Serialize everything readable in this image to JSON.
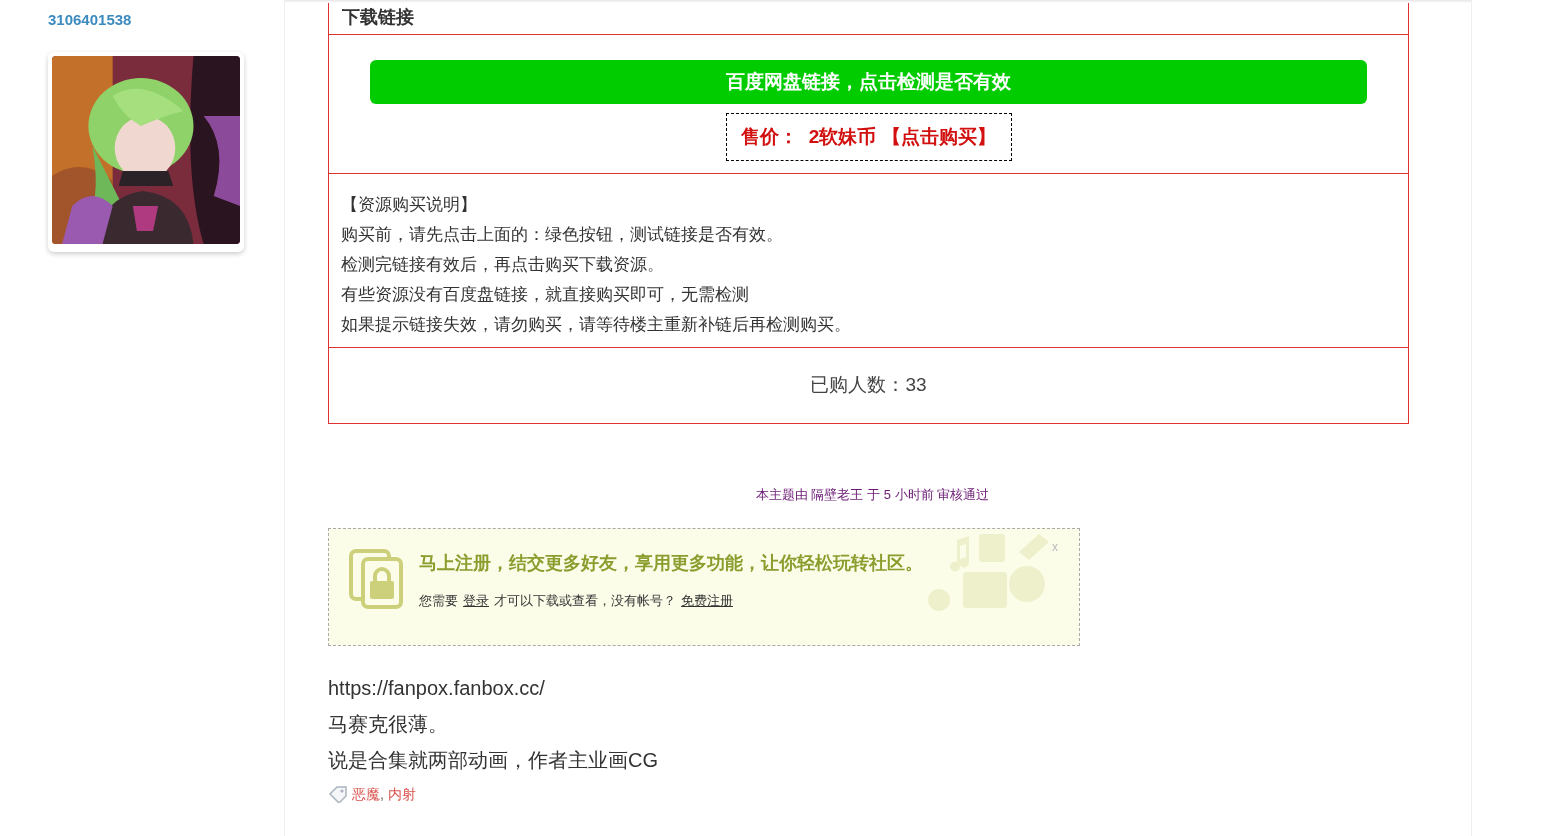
{
  "sidebar": {
    "username": "3106401538"
  },
  "download": {
    "header": "下载链接",
    "check_button": "百度网盘链接，点击检测是否有效",
    "price_button": "售价：  2软妹币 【点击购买】",
    "notes_title": "【资源购买说明】",
    "notes": [
      "购买前，请先点击上面的：绿色按钮，测试链接是否有效。",
      "检测完链接有效后，再点击购买下载资源。",
      "有些资源没有百度盘链接，就直接购买即可，无需检测",
      "如果提示链接失效，请勿购买，请等待楼主重新补链后再检测购买。"
    ],
    "buyers": "已购人数：33"
  },
  "moderation": "本主题由 隔壁老王 于 5 小时前 审核通过",
  "register_prompt": {
    "headline": "马上注册，结交更多好友，享用更多功能，让你轻松玩转社区。",
    "text_before": "您需要",
    "login_link": "登录",
    "text_middle": "才可以下载或查看，没有帐号？",
    "register_link": "免费注册",
    "close": "x"
  },
  "post_lines": [
    "https://fanpox.fanbox.cc/",
    "马赛克很薄。",
    "说是合集就两部动画，作者主业画CG"
  ],
  "tags": [
    "恶魔",
    "内射"
  ],
  "tag_separator": ","
}
